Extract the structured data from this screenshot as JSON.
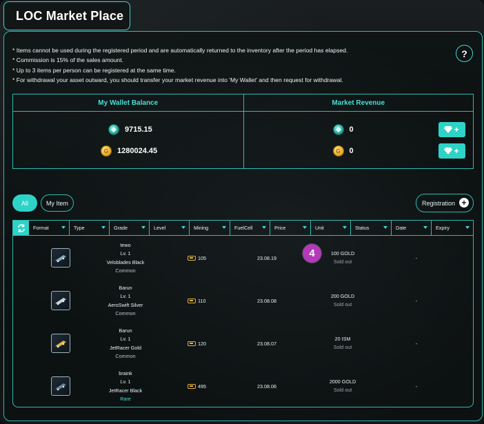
{
  "app": {
    "title": "LOC Market Place"
  },
  "help_label": "?",
  "notes": [
    "*  Items cannot be used during the registered period and are automatically returned to the inventory after the period has elapsed.",
    "*  Commission is 15% of the sales amount.",
    "*  Up to 3 items per person can be registered at the same time.",
    "*  For withdrawal your asset outward, you should transfer your market revenue into 'My Wallet' and then request for withdrawal."
  ],
  "wallet": {
    "balance_title": "My Wallet Balance",
    "revenue_title": "Market Revenue",
    "balance": {
      "diamond": "9715.15",
      "gold": "1280024.45"
    },
    "revenue": {
      "diamond": "0",
      "gold": "0"
    },
    "add_label": "+",
    "gold_coin_letter": "G"
  },
  "filters": {
    "all": "All",
    "my_item": "My Item",
    "registration": "Registration",
    "registration_plus": "+"
  },
  "table": {
    "columns": [
      "Format",
      "Type",
      "Grade",
      "Level",
      "Mining",
      "FuelCell",
      "Price",
      "Unit",
      "Status",
      "Date",
      "Expiry"
    ],
    "rows": [
      {
        "seller": "tewo",
        "level": "Lv. 1",
        "name": "Veloblades Black",
        "rarity": "Common",
        "mining": "105",
        "date": "23.08.19",
        "price": "100 GOLD",
        "status": "Sold out",
        "expiry": "-"
      },
      {
        "seller": "Barun",
        "level": "Lv. 1",
        "name": "AeroSwift Silver",
        "rarity": "Common",
        "mining": "110",
        "date": "23.08.08",
        "price": "200 GOLD",
        "status": "Sold out",
        "expiry": "-"
      },
      {
        "seller": "Barun",
        "level": "Lv. 1",
        "name": "JetRacer Gold",
        "rarity": "Common",
        "mining": "120",
        "date": "23.08.07",
        "price": "20 ISM",
        "status": "Sold out",
        "expiry": "-"
      },
      {
        "seller": "braink",
        "level": "Lv. 1",
        "name": "JetRacer Black",
        "rarity": "Rare",
        "mining": "495",
        "date": "23.08.06",
        "price": "2000 GOLD",
        "status": "Sold out",
        "expiry": "-"
      }
    ]
  },
  "overlay_badge": "4",
  "icons": {
    "refresh": "refresh-icon",
    "help": "help-icon",
    "gem": "diamond-icon",
    "coin_gold": "gold-coin-icon",
    "coin_diamond": "diamond-coin-icon",
    "chip": "mining-chip-icon",
    "item": "skate-item-icon"
  },
  "colors": {
    "accent": "#2ed3c7",
    "border": "#2fbcb4",
    "gold": "#e5b33a",
    "badge": "#b43ab8"
  }
}
